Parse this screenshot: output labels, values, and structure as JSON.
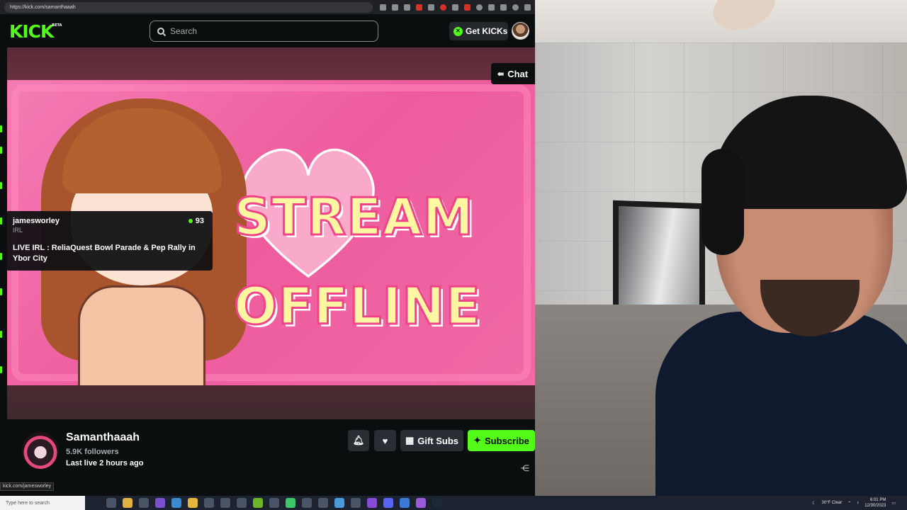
{
  "browser": {
    "url": "https://kick.com/samanthaaah"
  },
  "header": {
    "logo": "KICK",
    "logo_badge": "BETA",
    "search_placeholder": "Search",
    "get_kicks_label": "Get KICKs"
  },
  "player": {
    "chat_label": "Chat",
    "offline_line1": "STREAM",
    "offline_line2": "OFFLINE"
  },
  "hover_card": {
    "username": "jamesworley",
    "category": "IRL",
    "viewers": "93",
    "title": "LIVE IRL : ReliaQuest Bowl Parade & Pep Rally in Ybor City"
  },
  "channel": {
    "name": "Samanthaaah",
    "followers": "5.9K followers",
    "last_live": "Last live 2 hours ago",
    "gift_label": "Gift Subs",
    "subscribe_label": "Subscribe"
  },
  "status_url": "kick.com/jamesworley",
  "taskbar": {
    "search_placeholder": "Type here to search",
    "weather": "30°F  Clear",
    "time": "6:01 PM",
    "date": "12/30/2023"
  },
  "colors": {
    "accent": "#53fc18",
    "background": "#0b0e0f",
    "offline_pink": "#ee5c9e",
    "offline_text": "#fff7a2"
  }
}
